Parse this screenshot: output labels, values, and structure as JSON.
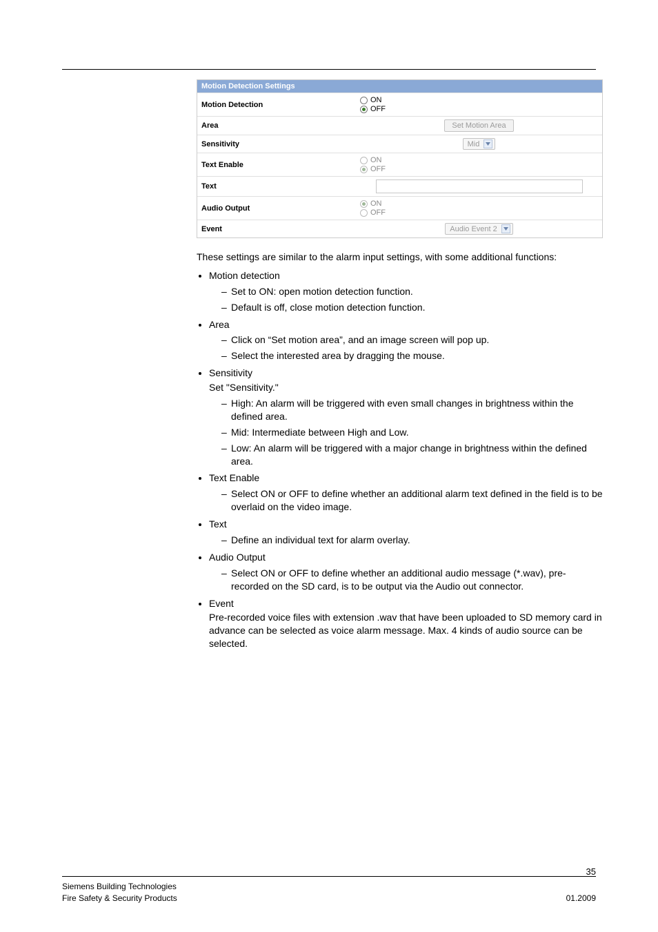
{
  "panel": {
    "title": "Motion Detection Settings",
    "rows": {
      "motion_detection": {
        "label": "Motion Detection",
        "on": "ON",
        "off": "OFF",
        "selected": "OFF",
        "disabled": false
      },
      "area": {
        "label": "Area",
        "button": "Set Motion Area"
      },
      "sensitivity": {
        "label": "Sensitivity",
        "value": "Mid"
      },
      "text_enable": {
        "label": "Text Enable",
        "on": "ON",
        "off": "OFF",
        "selected": "OFF",
        "disabled": true
      },
      "text": {
        "label": "Text",
        "value": ""
      },
      "audio_output": {
        "label": "Audio Output",
        "on": "ON",
        "off": "OFF",
        "selected": "ON",
        "disabled": true
      },
      "event": {
        "label": "Event",
        "value": "Audio Event 2"
      }
    }
  },
  "body": {
    "intro": "These settings are similar to the alarm input settings, with some additional functions:",
    "items": [
      {
        "title": "Motion detection",
        "sub": [
          "Set to ON: open motion detection function.",
          "Default is off, close motion detection function."
        ]
      },
      {
        "title": "Area",
        "sub": [
          "Click on “Set motion area”, and an image screen will pop up.",
          "Select the interested area by dragging the mouse."
        ]
      },
      {
        "title": "Sensitivity",
        "note": "Set \"Sensitivity.\"",
        "sub": [
          "High: An alarm will be triggered with even small changes in brightness within the defined area.",
          "Mid: Intermediate between High and Low.",
          "Low: An alarm will be triggered with a major change in brightness within the defined area."
        ]
      },
      {
        "title": "Text Enable",
        "sub": [
          "Select ON or OFF to define whether an additional alarm text defined in the field is to be overlaid on the video image."
        ],
        "sub_indent_second_line": true
      },
      {
        "title": "Text",
        "sub": [
          "Define an individual text for alarm overlay."
        ]
      },
      {
        "title": "Audio Output",
        "sub": [
          "Select ON or OFF to define whether an additional audio message (*.wav), pre-recorded on the SD card, is to be output via the Audio out connector."
        ]
      },
      {
        "title": "Event",
        "note": "Pre-recorded voice files with extension .wav that have been uploaded to SD memory card in advance can be selected as voice alarm message. Max. 4 kinds of audio source can be selected."
      }
    ]
  },
  "footer": {
    "page": "35",
    "left1": "Siemens Building Technologies",
    "left2": "Fire Safety & Security Products",
    "right2": "01.2009"
  }
}
